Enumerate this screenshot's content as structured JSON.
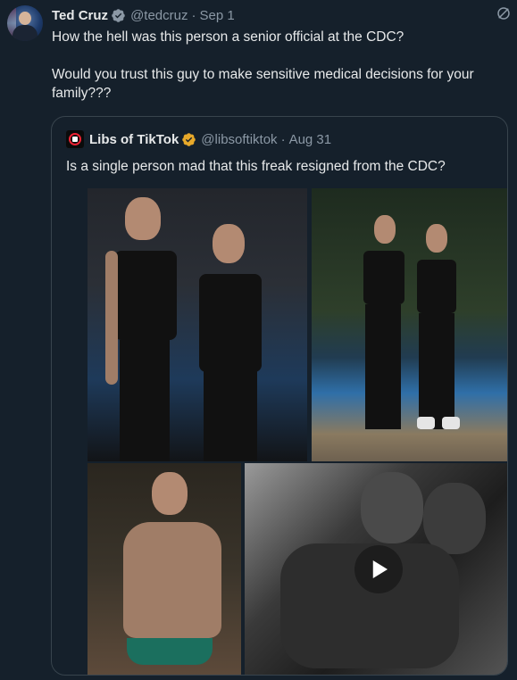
{
  "tweet": {
    "author_name": "Ted Cruz",
    "author_handle": "@tedcruz",
    "separator": "·",
    "date": "Sep 1",
    "text_line1": "How the hell was this person a senior official at the CDC?",
    "text_line2": "Would you trust this guy to make sensitive medical decisions for your family???"
  },
  "quoted": {
    "author_name": "Libs of TikTok",
    "author_handle": "@libsoftiktok",
    "separator": "·",
    "date": "Aug 31",
    "text": "Is a single person mad that this freak resigned from the CDC?"
  },
  "icons": {
    "verified": "verified-badge-icon",
    "grok": "grok-icon",
    "play": "play-icon"
  },
  "colors": {
    "background": "#15202b",
    "text": "#e7e9ea",
    "muted": "#8b98a5",
    "border": "#38444d",
    "verified_gold": "#e8a92a"
  }
}
